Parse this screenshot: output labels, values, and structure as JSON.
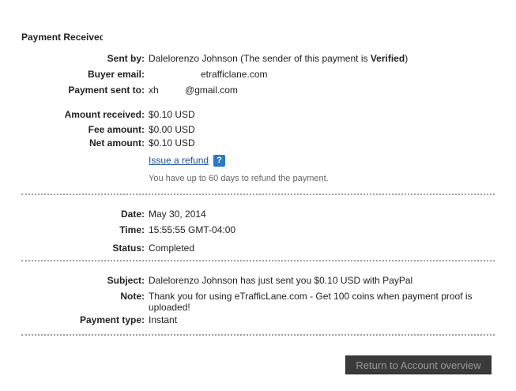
{
  "title": "Payment Receivec",
  "sender": {
    "label": "Sent by:",
    "prefix": "Dalelorenzo Johnson (The sender of this payment is ",
    "status": "Verified",
    "suffix": ")"
  },
  "buyer_email": {
    "label": "Buyer email:",
    "value": "etrafficlane.com"
  },
  "payment_sent_to": {
    "label": "Payment sent to:",
    "value": "xh          @gmail.com"
  },
  "amounts": {
    "received": {
      "label": "Amount received:",
      "value": "$0.10 USD"
    },
    "fee": {
      "label": "Fee amount:",
      "value": "$0.00 USD"
    },
    "net": {
      "label": "Net amount:",
      "value": "$0.10 USD"
    }
  },
  "refund": {
    "link": "Issue a refund",
    "help_icon": "help-icon",
    "help_glyph": "?",
    "hint": "You have up to 60 days to refund the payment."
  },
  "details": {
    "date": {
      "label": "Date:",
      "value": "May 30, 2014"
    },
    "time": {
      "label": "Time:",
      "value": "15:55:55 GMT-04:00"
    },
    "status": {
      "label": "Status:",
      "value": "Completed"
    }
  },
  "message": {
    "subject": {
      "label": "Subject:",
      "value": "Dalelorenzo Johnson has just sent you $0.10 USD with PayPal"
    },
    "note": {
      "label": "Note:",
      "value": "Thank you for using eTrafficLane.com - Get 100 coins when payment proof is uploaded!"
    },
    "payment_type": {
      "label": "Payment type:",
      "value": "Instant"
    }
  },
  "return_button": "Return to Account overview"
}
